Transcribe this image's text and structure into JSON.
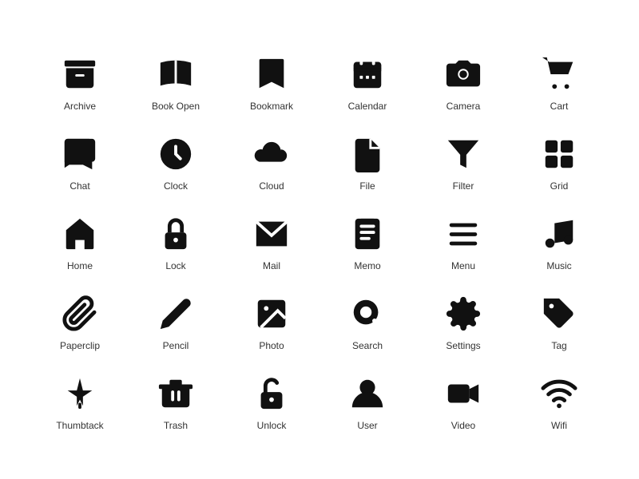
{
  "icons": [
    {
      "name": "archive-icon",
      "label": "Archive"
    },
    {
      "name": "book-open-icon",
      "label": "Book Open"
    },
    {
      "name": "bookmark-icon",
      "label": "Bookmark"
    },
    {
      "name": "calendar-icon",
      "label": "Calendar"
    },
    {
      "name": "camera-icon",
      "label": "Camera"
    },
    {
      "name": "cart-icon",
      "label": "Cart"
    },
    {
      "name": "chat-icon",
      "label": "Chat"
    },
    {
      "name": "clock-icon",
      "label": "Clock"
    },
    {
      "name": "cloud-icon",
      "label": "Cloud"
    },
    {
      "name": "file-icon",
      "label": "File"
    },
    {
      "name": "filter-icon",
      "label": "Filter"
    },
    {
      "name": "grid-icon",
      "label": "Grid"
    },
    {
      "name": "home-icon",
      "label": "Home"
    },
    {
      "name": "lock-icon",
      "label": "Lock"
    },
    {
      "name": "mail-icon",
      "label": "Mail"
    },
    {
      "name": "memo-icon",
      "label": "Memo"
    },
    {
      "name": "menu-icon",
      "label": "Menu"
    },
    {
      "name": "music-icon",
      "label": "Music"
    },
    {
      "name": "paperclip-icon",
      "label": "Paperclip"
    },
    {
      "name": "pencil-icon",
      "label": "Pencil"
    },
    {
      "name": "photo-icon",
      "label": "Photo"
    },
    {
      "name": "search-icon",
      "label": "Search"
    },
    {
      "name": "settings-icon",
      "label": "Settings"
    },
    {
      "name": "tag-icon",
      "label": "Tag"
    },
    {
      "name": "thumbtack-icon",
      "label": "Thumbtack"
    },
    {
      "name": "trash-icon",
      "label": "Trash"
    },
    {
      "name": "unlock-icon",
      "label": "Unlock"
    },
    {
      "name": "user-icon",
      "label": "User"
    },
    {
      "name": "video-icon",
      "label": "Video"
    },
    {
      "name": "wifi-icon",
      "label": "Wifi"
    }
  ]
}
